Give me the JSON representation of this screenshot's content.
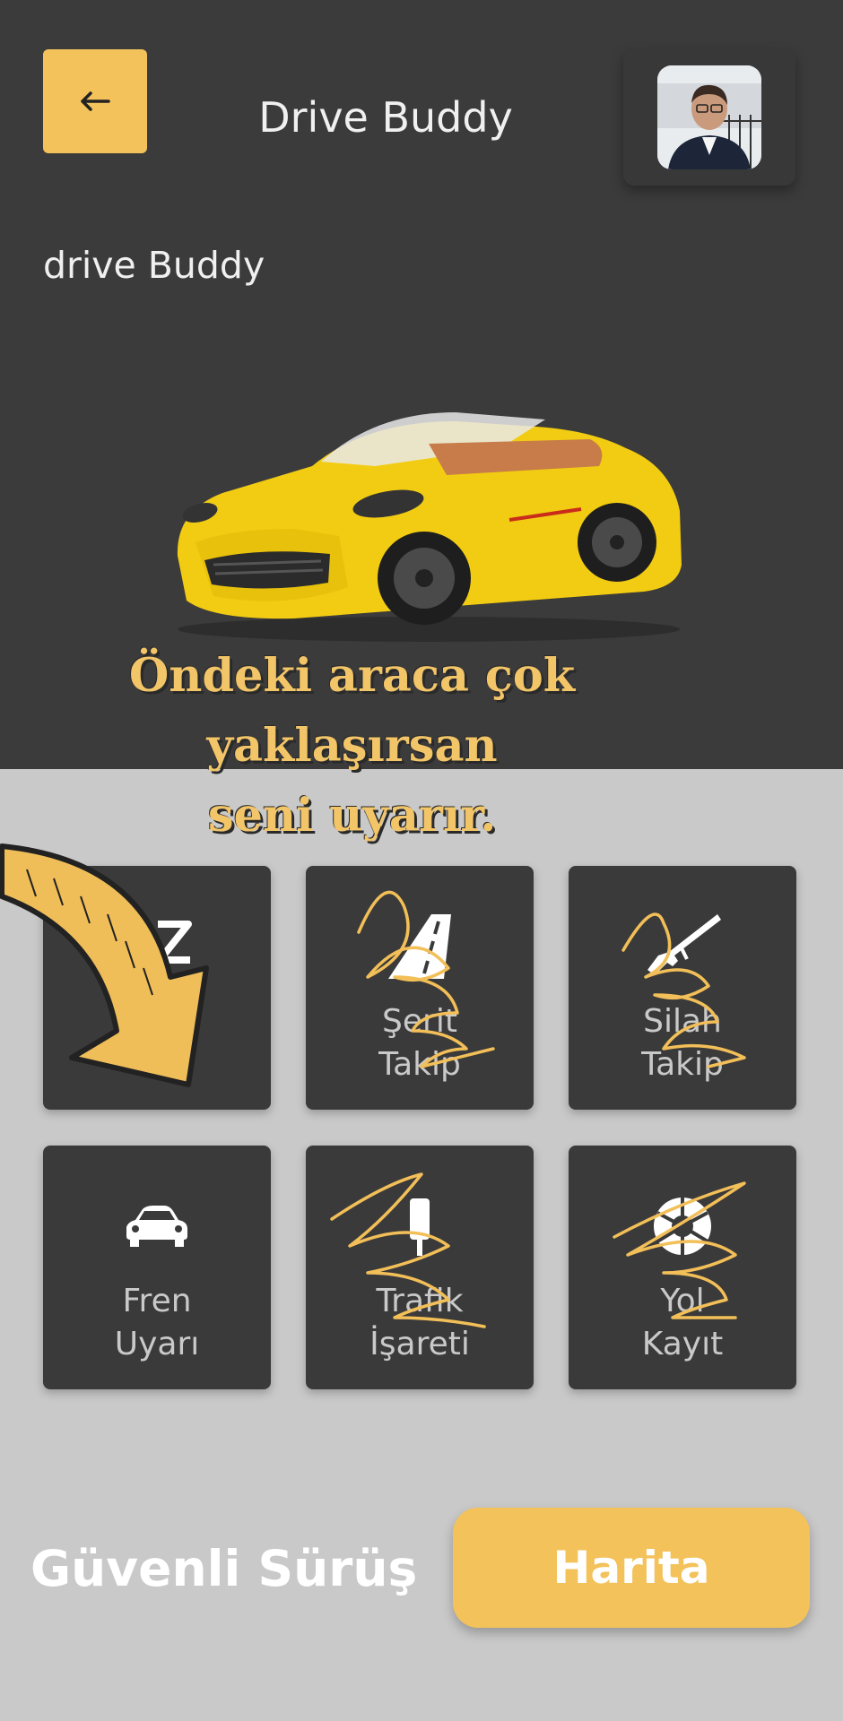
{
  "header": {
    "title": "Drive Buddy",
    "back_icon": "arrow-left-icon"
  },
  "hero": {
    "subtitle": "drive Buddy",
    "banner_line1": "Öndeki araca çok yaklaşırsan",
    "banner_line2": "seni uyarır."
  },
  "features": [
    {
      "label1": "",
      "label2": "",
      "icon": "sleep-zz-icon"
    },
    {
      "label1": "Şerit",
      "label2": "Takip",
      "icon": "road-icon"
    },
    {
      "label1": "Silah",
      "label2": "Takip",
      "icon": "rifle-icon"
    },
    {
      "label1": "Fren",
      "label2": "Uyarı",
      "icon": "car-icon"
    },
    {
      "label1": "Trafik",
      "label2": "İşareti",
      "icon": "traffic-sign-icon"
    },
    {
      "label1": "Yol",
      "label2": "Kayıt",
      "icon": "camera-aperture-icon"
    }
  ],
  "footer": {
    "title": "Güvenli Sürüş",
    "map_button": "Harita"
  },
  "colors": {
    "accent": "#f3c25b",
    "dark": "#3c3b3b",
    "light": "#c9c9c9"
  }
}
